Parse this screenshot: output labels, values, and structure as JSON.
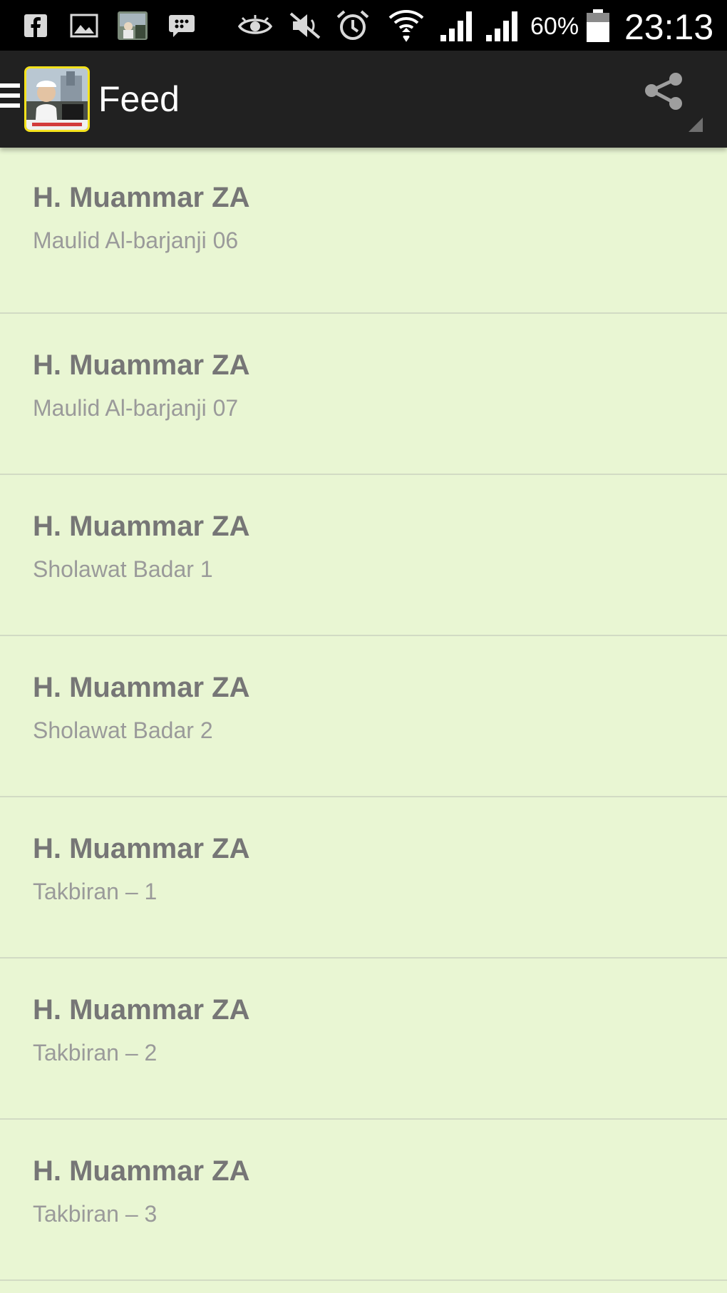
{
  "status_bar": {
    "icons": [
      "facebook-icon",
      "gallery-icon",
      "photo-thumbnail-icon",
      "bbm-icon",
      "eye-icon",
      "mute-icon",
      "alarm-icon",
      "wifi-icon",
      "signal-icon",
      "signal-icon"
    ],
    "battery_percent": "60%",
    "time": "23:13"
  },
  "action_bar": {
    "title": "Feed",
    "app_icon": "app-logo",
    "drawer_icon": "menu-icon",
    "share_icon": "share-icon"
  },
  "feed": {
    "items": [
      {
        "title": "H. Muammar ZA",
        "subtitle": "Maulid Al-barjanji 06"
      },
      {
        "title": "H. Muammar ZA",
        "subtitle": "Maulid Al-barjanji 07"
      },
      {
        "title": "H. Muammar ZA",
        "subtitle": "Sholawat Badar 1"
      },
      {
        "title": "H. Muammar ZA",
        "subtitle": "Sholawat Badar 2"
      },
      {
        "title": "H. Muammar ZA",
        "subtitle": "Takbiran – 1"
      },
      {
        "title": "H. Muammar ZA",
        "subtitle": "Takbiran – 2"
      },
      {
        "title": "H. Muammar ZA",
        "subtitle": "Takbiran – 3"
      }
    ]
  },
  "colors": {
    "background": "#e9f6d3",
    "action_bar": "#212121",
    "status_bar": "#000000",
    "title_text": "#767676",
    "subtitle_text": "#9a9a9a",
    "divider": "#d2dbc4",
    "app_icon_border": "#f4e21c"
  }
}
